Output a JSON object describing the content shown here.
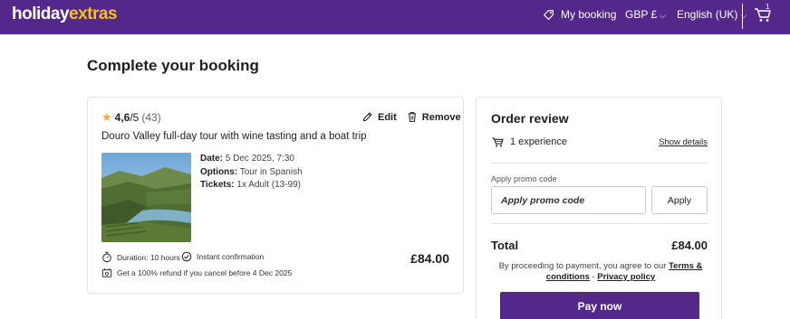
{
  "header": {
    "logo_part1": "holiday",
    "logo_part2": "extras",
    "my_booking": "My booking",
    "currency": "GBP £",
    "language": "English (UK)",
    "cart_count": "1",
    "brand_color": "#54278a",
    "accent_color": "#f5c21b"
  },
  "page": {
    "title": "Complete your booking"
  },
  "booking_card": {
    "rating_score": "4,6",
    "rating_outof": "/5",
    "rating_count": "(43)",
    "edit_label": "Edit",
    "remove_label": "Remove",
    "product_title": "Douro Valley full-day tour with wine tasting and a boat trip",
    "details": {
      "date_label": "Date:",
      "date_value": "5 Dec 2025, 7:30",
      "options_label": "Options:",
      "options_value": "Tour in Spanish",
      "tickets_label": "Tickets:",
      "tickets_value": "1x Adult (13-99)"
    },
    "duration": "Duration: 10 hours",
    "confirmation": "Instant confirmation",
    "refund": "Get a 100% refund if you cancel before 4 Dec 2025",
    "price": "£84.00",
    "icons": [
      "star-icon",
      "pencil-icon",
      "trash-icon",
      "stopwatch-icon",
      "check-circle-icon",
      "refund-icon"
    ]
  },
  "order_review": {
    "title": "Order review",
    "experience_count": "1 experience",
    "show_details": "Show details",
    "promo_label": "Apply promo code",
    "promo_placeholder": "Apply promo code",
    "apply_button": "Apply",
    "total_label": "Total",
    "total_value": "£84.00",
    "terms_prefix": "By proceeding to payment, you agree to our",
    "terms_link": "Terms & conditions",
    "terms_separator": " - ",
    "privacy_link": "Privacy policy",
    "pay_button": "Pay now"
  }
}
